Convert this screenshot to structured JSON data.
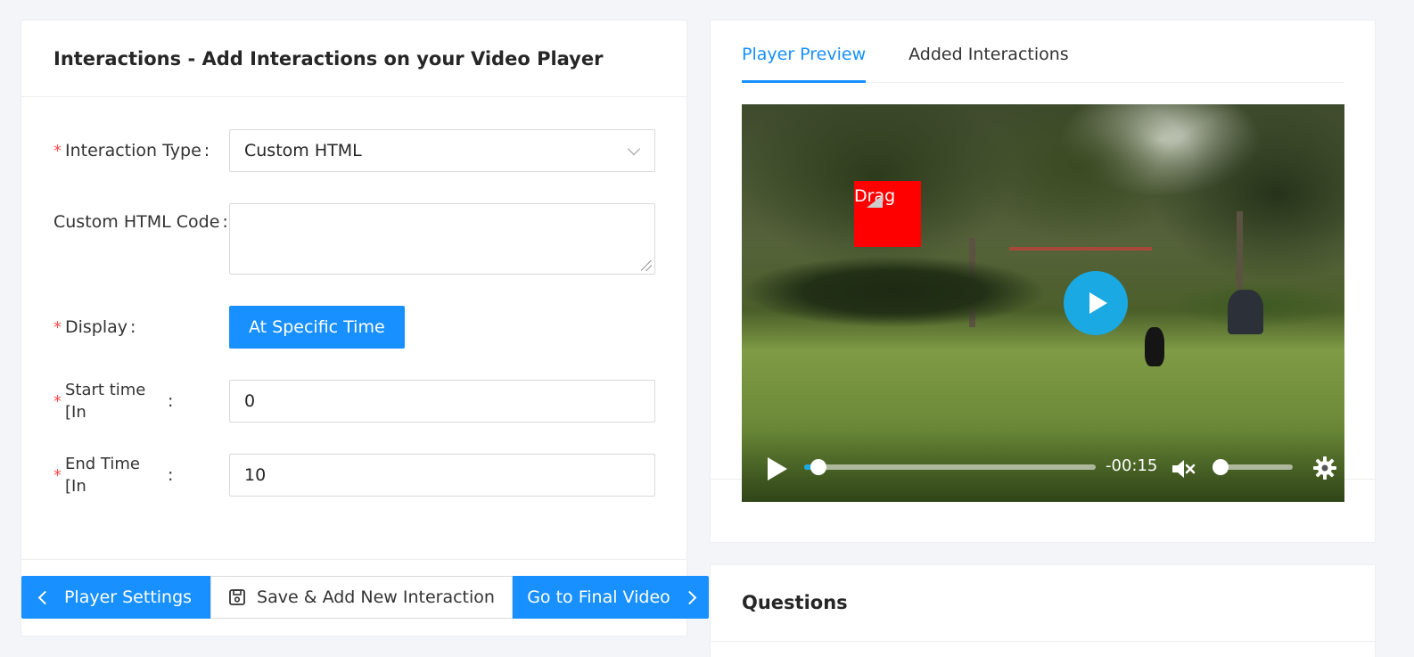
{
  "form_panel": {
    "title": "Interactions - Add Interactions on your Video Player",
    "fields": {
      "interaction_type": {
        "label": "Interaction Type",
        "value": "Custom HTML"
      },
      "custom_html": {
        "label": "Custom HTML Code",
        "value": ""
      },
      "display": {
        "label": "Display",
        "button_label": "At Specific Time"
      },
      "start_time": {
        "label": "Start time [In Seconds]",
        "value": "0"
      },
      "end_time": {
        "label": "End Time [In Seconds]",
        "value": "10"
      }
    },
    "colon": ":",
    "required_mark": "*"
  },
  "footer": {
    "player_settings": "Player Settings",
    "save_add": "Save & Add New Interaction",
    "final_video": "Go to Final Video"
  },
  "preview_panel": {
    "tabs": [
      {
        "label": "Player Preview",
        "active": true
      },
      {
        "label": "Added Interactions",
        "active": false
      }
    ],
    "player": {
      "overlay_text": "Drag",
      "time_remaining": "-00:15",
      "progress": 0.05,
      "volume": 0
    }
  },
  "questions_panel": {
    "title": "Questions"
  },
  "colors": {
    "primary": "#1890ff",
    "required": "#ff4d4f",
    "overlay": "#ff0000",
    "play_button": "#1aa9e2"
  },
  "icons": [
    "chevron-down-icon",
    "chevron-left-icon",
    "save-icon",
    "chevron-right-icon",
    "play-icon",
    "mute-icon",
    "gear-icon"
  ]
}
